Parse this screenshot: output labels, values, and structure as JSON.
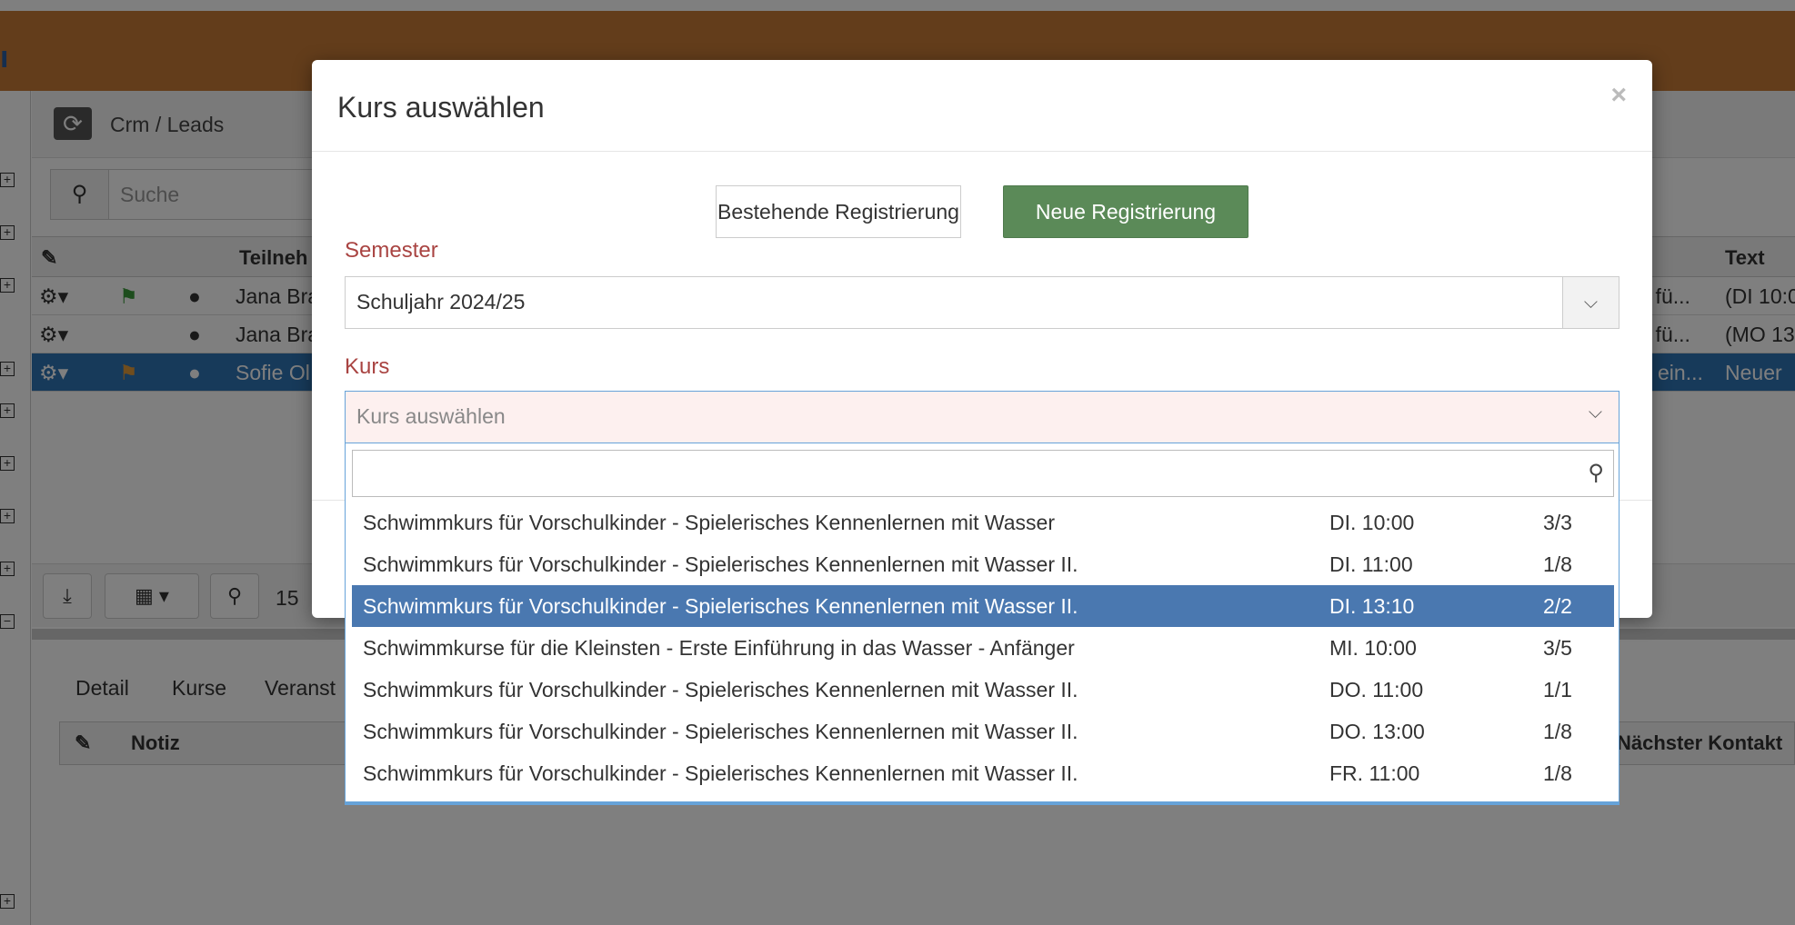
{
  "background": {
    "breadcrumb": "Crm / Leads",
    "search_placeholder": "Suche",
    "grid_headers": {
      "participant": "Teilneh",
      "text": "Text"
    },
    "rows": [
      {
        "name": "Jana Bra",
        "course_frag": "rs fü...",
        "text": "(DI 10:0"
      },
      {
        "name": "Jana Bra",
        "course_frag": "rs fü...",
        "text": "(MO 13"
      },
      {
        "name": "Sofie Ol",
        "course_frag": "ein...",
        "text": "Neuer"
      }
    ],
    "page_size": "15",
    "subtabs": [
      "Detail",
      "Kurse",
      "Veranst"
    ],
    "subgrid_headers": {
      "note": "Notiz",
      "next_contact": "Nächster Kontakt"
    },
    "left_rail_letter": "n"
  },
  "modal": {
    "title": "Kurs auswählen",
    "close": "×",
    "btn_existing": "Bestehende Registrierung",
    "btn_new": "Neue Registrierung",
    "semester_label": "Semester",
    "semester_value": "Schuljahr 2024/25",
    "kurs_label": "Kurs",
    "kurs_placeholder": "Kurs auswählen"
  },
  "dropdown": {
    "options": [
      {
        "name": "Schwimmkurs für Vorschulkinder - Spielerisches Kennenlernen mit Wasser",
        "time": "DI. 10:00",
        "slots": "3/3"
      },
      {
        "name": "Schwimmkurs für Vorschulkinder - Spielerisches Kennenlernen mit Wasser II.",
        "time": "DI. 11:00",
        "slots": "1/8"
      },
      {
        "name": "Schwimmkurs für Vorschulkinder - Spielerisches Kennenlernen mit Wasser II.",
        "time": "DI. 13:10",
        "slots": "2/2"
      },
      {
        "name": "Schwimmkurse für die Kleinsten - Erste Einführung in das Wasser - Anfänger",
        "time": "MI. 10:00",
        "slots": "3/5"
      },
      {
        "name": "Schwimmkurs für Vorschulkinder - Spielerisches Kennenlernen mit Wasser II.",
        "time": "DO. 11:00",
        "slots": "1/1"
      },
      {
        "name": "Schwimmkurs für Vorschulkinder - Spielerisches Kennenlernen mit Wasser II.",
        "time": "DO. 13:00",
        "slots": "1/8"
      },
      {
        "name": "Schwimmkurs für Vorschulkinder - Spielerisches Kennenlernen mit Wasser II.",
        "time": "FR. 11:00",
        "slots": "1/8"
      }
    ]
  }
}
